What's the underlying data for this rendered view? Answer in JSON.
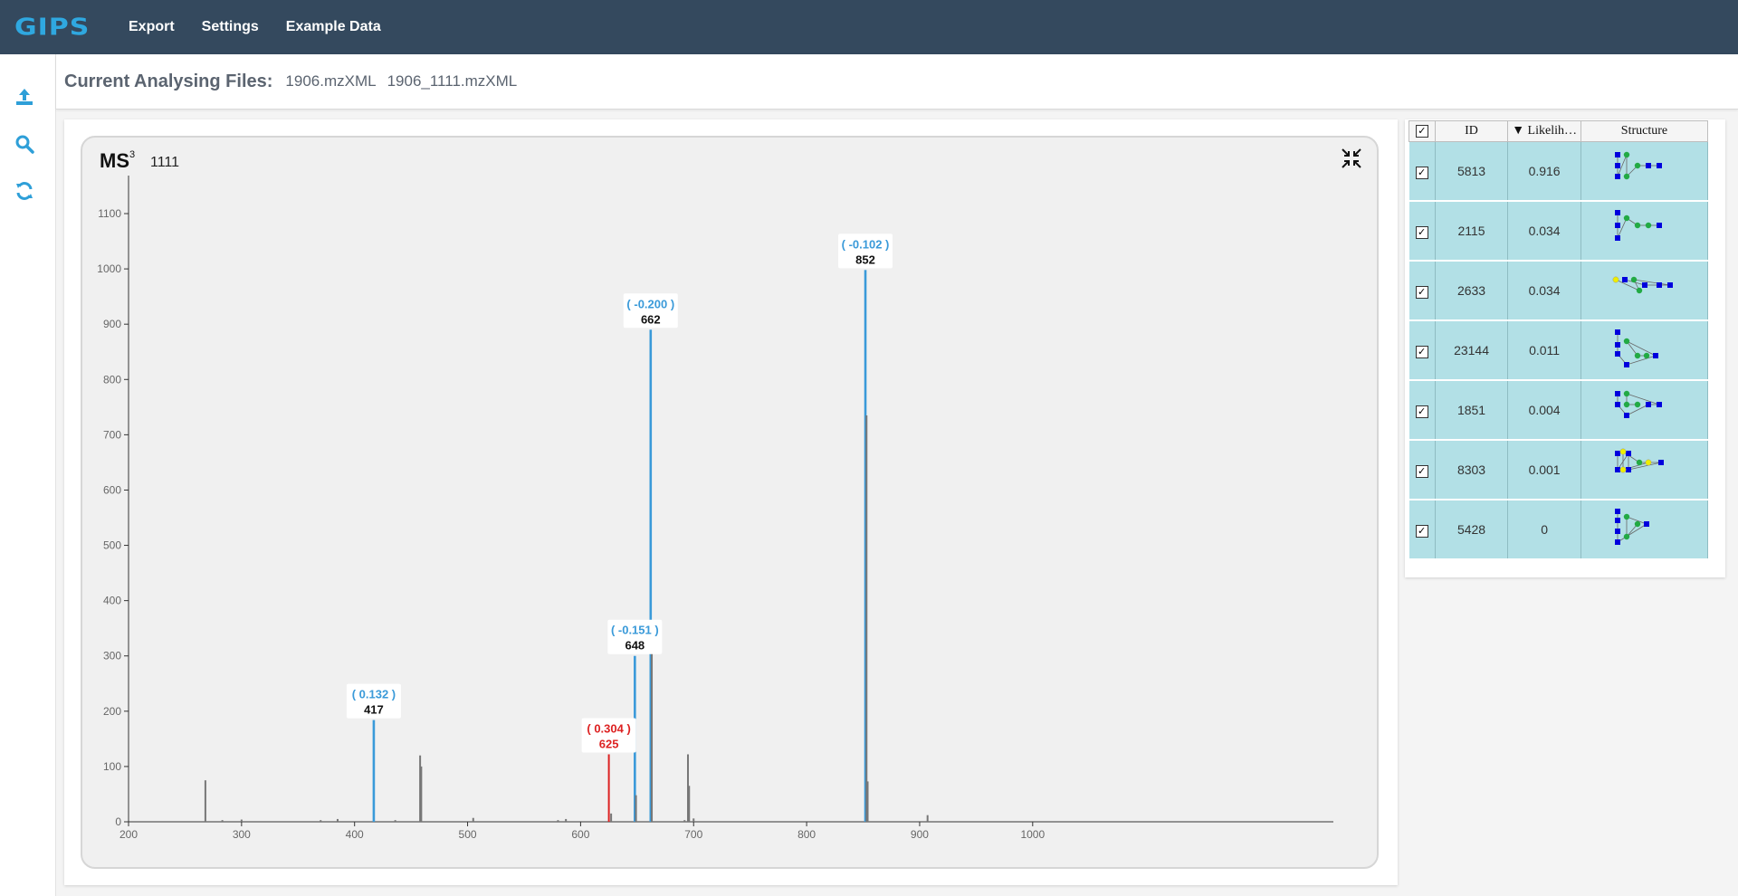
{
  "app": {
    "brand": "GIPS",
    "nav": [
      "Export",
      "Settings",
      "Example Data"
    ]
  },
  "sidebar": {
    "icons": [
      "upload-icon",
      "search-icon",
      "refresh-icon"
    ],
    "accent": "#2e9fd8"
  },
  "files": {
    "title": "Current Analysing Files:",
    "names": [
      "1906.mzXML",
      "1906_1111.mzXML"
    ]
  },
  "chart_header": {
    "ms_level_label": "MS",
    "ms_level_sup": "3",
    "precursor": "1111"
  },
  "chart_data": {
    "type": "bar",
    "xlim": [
      200,
      1055
    ],
    "ylim": [
      0,
      1150
    ],
    "x_ticks": [
      200,
      300,
      400,
      500,
      600,
      700,
      800,
      900,
      1000
    ],
    "y_ticks": [
      0,
      100,
      200,
      300,
      400,
      500,
      600,
      700,
      800,
      900,
      1000,
      1100
    ],
    "colors": {
      "matched": "#3a9ad9",
      "mismatch": "#dd2222",
      "unmatched": "#777777"
    },
    "peaks": [
      {
        "mz": 268,
        "intensity": 75,
        "kind": "unmatched"
      },
      {
        "mz": 283,
        "intensity": 3,
        "kind": "unmatched"
      },
      {
        "mz": 300,
        "intensity": 4,
        "kind": "unmatched"
      },
      {
        "mz": 370,
        "intensity": 3,
        "kind": "unmatched"
      },
      {
        "mz": 385,
        "intensity": 5,
        "kind": "unmatched"
      },
      {
        "mz": 417,
        "intensity": 184,
        "kind": "matched"
      },
      {
        "mz": 436,
        "intensity": 3,
        "kind": "unmatched"
      },
      {
        "mz": 458,
        "intensity": 120,
        "kind": "unmatched"
      },
      {
        "mz": 459,
        "intensity": 100,
        "kind": "unmatched"
      },
      {
        "mz": 505,
        "intensity": 7,
        "kind": "unmatched"
      },
      {
        "mz": 580,
        "intensity": 3,
        "kind": "unmatched"
      },
      {
        "mz": 587,
        "intensity": 5,
        "kind": "unmatched"
      },
      {
        "mz": 625,
        "intensity": 122,
        "kind": "mismatch"
      },
      {
        "mz": 627,
        "intensity": 15,
        "kind": "unmatched"
      },
      {
        "mz": 648,
        "intensity": 300,
        "kind": "matched"
      },
      {
        "mz": 649,
        "intensity": 48,
        "kind": "unmatched"
      },
      {
        "mz": 662,
        "intensity": 890,
        "kind": "matched"
      },
      {
        "mz": 663,
        "intensity": 315,
        "kind": "unmatched"
      },
      {
        "mz": 692,
        "intensity": 3,
        "kind": "unmatched"
      },
      {
        "mz": 695,
        "intensity": 122,
        "kind": "unmatched"
      },
      {
        "mz": 696,
        "intensity": 65,
        "kind": "unmatched"
      },
      {
        "mz": 700,
        "intensity": 6,
        "kind": "unmatched"
      },
      {
        "mz": 852,
        "intensity": 998,
        "kind": "matched"
      },
      {
        "mz": 853,
        "intensity": 735,
        "kind": "unmatched"
      },
      {
        "mz": 854,
        "intensity": 73,
        "kind": "unmatched"
      },
      {
        "mz": 907,
        "intensity": 12,
        "kind": "unmatched"
      }
    ],
    "annotations": [
      {
        "mz": 417,
        "intensity": 184,
        "error": "( 0.132 )",
        "label": "417",
        "kind": "matched"
      },
      {
        "mz": 625,
        "intensity": 122,
        "error": "( 0.304 )",
        "label": "625",
        "kind": "mismatch"
      },
      {
        "mz": 648,
        "intensity": 300,
        "error": "( -0.151 )",
        "label": "648",
        "kind": "matched"
      },
      {
        "mz": 662,
        "intensity": 890,
        "error": "( -0.200 )",
        "label": "662",
        "kind": "matched"
      },
      {
        "mz": 852,
        "intensity": 998,
        "error": "( -0.102 )",
        "label": "852",
        "kind": "matched"
      }
    ]
  },
  "table": {
    "headers": [
      "ID",
      "▼ Likelih…",
      "Structure"
    ],
    "rows": [
      {
        "id": "5813",
        "likelihood": "0.916",
        "checked": true
      },
      {
        "id": "2115",
        "likelihood": "0.034",
        "checked": true
      },
      {
        "id": "2633",
        "likelihood": "0.034",
        "checked": true
      },
      {
        "id": "23144",
        "likelihood": "0.011",
        "checked": true
      },
      {
        "id": "1851",
        "likelihood": "0.004",
        "checked": true
      },
      {
        "id": "8303",
        "likelihood": "0.001",
        "checked": true
      },
      {
        "id": "5428",
        "likelihood": "0",
        "checked": true
      }
    ],
    "glycan_colors": {
      "glcnac": "#0000dd",
      "man": "#22aa44",
      "gal": "#eeee00"
    }
  }
}
